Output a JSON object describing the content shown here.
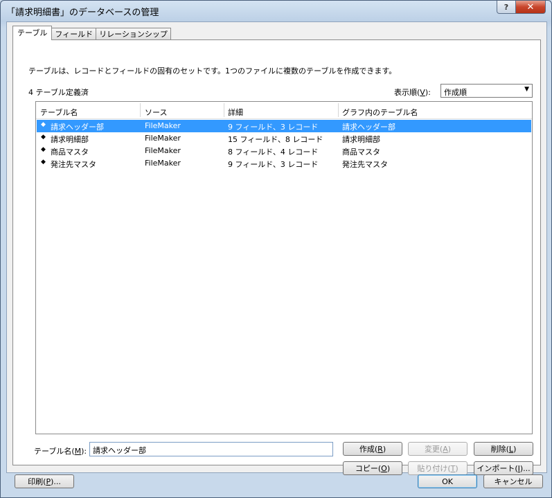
{
  "window": {
    "title": "「請求明細書」のデータベースの管理",
    "help_label": "?",
    "close_label": "✕"
  },
  "tabs": [
    {
      "label": "テーブル"
    },
    {
      "label": "フィールド"
    },
    {
      "label": "リレーションシップ"
    }
  ],
  "description": "テーブルは、レコードとフィールドの固有のセットです。1つのファイルに複数のテーブルを作成できます。",
  "table_count": "4 テーブル定義済",
  "sort": {
    "label_prefix": "表示順(",
    "label_key": "V",
    "label_suffix": "):",
    "value": "作成順"
  },
  "columns": [
    "テーブル名",
    "ソース",
    "詳細",
    "グラフ内のテーブル名"
  ],
  "rows": [
    {
      "name": "請求ヘッダー部",
      "source": "FileMaker",
      "detail": "9 フィールド、3 レコード",
      "graph": "請求ヘッダー部"
    },
    {
      "name": "請求明細部",
      "source": "FileMaker",
      "detail": "15 フィールド、8 レコード",
      "graph": "請求明細部"
    },
    {
      "name": "商品マスタ",
      "source": "FileMaker",
      "detail": "8 フィールド、4 レコード",
      "graph": "商品マスタ"
    },
    {
      "name": "発注先マスタ",
      "source": "FileMaker",
      "detail": "9 フィールド、3 レコード",
      "graph": "発注先マスタ"
    }
  ],
  "selected_row": 0,
  "name_field": {
    "label_prefix": "テーブル名(",
    "label_key": "M",
    "label_suffix": "):",
    "value": "請求ヘッダー部"
  },
  "buttons": {
    "create": {
      "prefix": "作成(",
      "key": "R",
      "suffix": ")"
    },
    "change": {
      "prefix": "変更(",
      "key": "A",
      "suffix": ")"
    },
    "delete": {
      "prefix": "削除(",
      "key": "L",
      "suffix": ")"
    },
    "copy": {
      "prefix": "コピー(",
      "key": "O",
      "suffix": ")"
    },
    "paste": {
      "prefix": "貼り付け(",
      "key": "T",
      "suffix": ")"
    },
    "import": {
      "prefix": "インポート(",
      "key": "I",
      "suffix": ")..."
    },
    "print": {
      "prefix": "印刷(",
      "key": "P",
      "suffix": ")..."
    },
    "ok": "OK",
    "cancel": "キャンセル"
  },
  "icons": {
    "row_handle": "updown-arrow-icon",
    "dropdown": "chevron-down-icon"
  }
}
